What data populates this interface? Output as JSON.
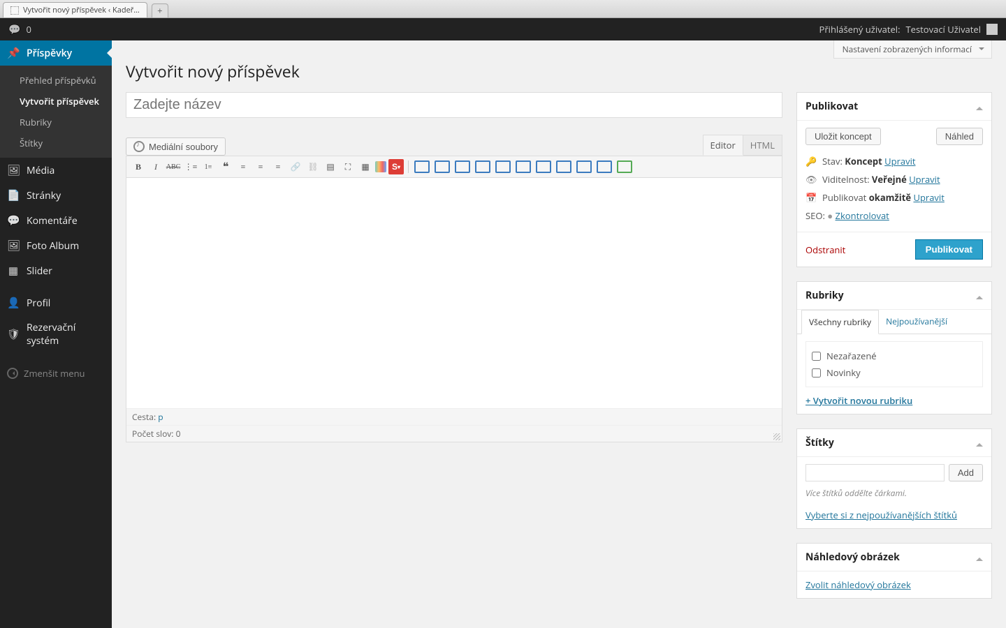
{
  "browser": {
    "tab_title": "Vytvořit nový příspěvek ‹ Kadeř…"
  },
  "adminbar": {
    "comment_count": "0",
    "logged_in_prefix": "Přihlášený uživatel: ",
    "user_name": "Testovací Uživatel"
  },
  "sidebar": {
    "items": [
      {
        "label": "Příspěvky",
        "icon": "📌"
      },
      {
        "label": "Média",
        "icon": "🖼"
      },
      {
        "label": "Stránky",
        "icon": "📄"
      },
      {
        "label": "Komentáře",
        "icon": "💬"
      },
      {
        "label": "Foto Album",
        "icon": "🖼"
      },
      {
        "label": "Slider",
        "icon": "▦"
      },
      {
        "label": "Profil",
        "icon": "👤"
      },
      {
        "label": "Rezervační systém",
        "icon": "🛡"
      }
    ],
    "submenu": [
      {
        "label": "Přehled příspěvků"
      },
      {
        "label": "Vytvořit příspěvek"
      },
      {
        "label": "Rubriky"
      },
      {
        "label": "Štítky"
      }
    ],
    "collapse": "Zmenšit menu"
  },
  "screen_options": "Nastavení zobrazených informací",
  "page_title": "Vytvořit nový příspěvek",
  "title_placeholder": "Zadejte název",
  "media_button": "Mediální soubory",
  "tabs": {
    "visual": "Editor",
    "text": "HTML"
  },
  "status": {
    "path_label": "Cesta: ",
    "path_value": "p",
    "wordcount_label": "Počet slov: ",
    "wordcount_value": "0"
  },
  "publish": {
    "title": "Publikovat",
    "save_draft": "Uložit koncept",
    "preview": "Náhled",
    "status_label": "Stav: ",
    "status_value": "Koncept",
    "edit": "Upravit",
    "visibility_label": "Viditelnost: ",
    "visibility_value": "Veřejné",
    "edit2": "Upravit",
    "schedule_label": "Publikovat ",
    "schedule_value": "okamžitě",
    "edit3": "Upravit",
    "seo_label": "SEO: ",
    "seo_link": "Zkontrolovat",
    "trash": "Odstranit",
    "publish_btn": "Publikovat"
  },
  "categories": {
    "title": "Rubriky",
    "tab_all": "Všechny rubriky",
    "tab_pop": "Nejpoužívanější",
    "items": [
      {
        "label": "Nezařazené"
      },
      {
        "label": "Novinky"
      }
    ],
    "add": "+ Vytvořit novou rubriku"
  },
  "tags": {
    "title": "Štítky",
    "add_btn": "Add",
    "hint": "Více štítků oddělte čárkami.",
    "choose": "Vyberte si z nejpoužívanějších štítků"
  },
  "featured": {
    "title": "Náhledový obrázek",
    "set": "Zvolit náhledový obrázek"
  }
}
